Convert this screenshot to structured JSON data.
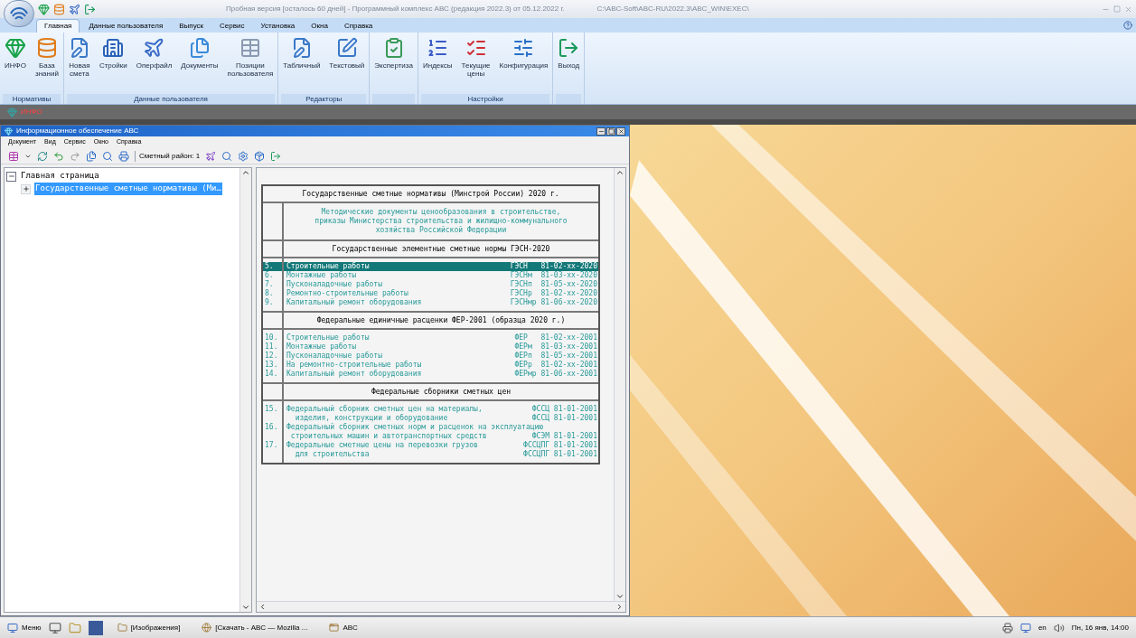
{
  "app": {
    "title": "Пробная версия [осталось 60 дней]  -  Программный комплекс АВС (редакция 2022.3) от 05.12.2022 г.",
    "path": "C:\\ABC-Soft\\ABC-RU\\2022.3\\ABC_WIN\\EXEC\\"
  },
  "ribbon_tabs": [
    {
      "label": "Главная",
      "selected": true
    },
    {
      "label": "Данные пользователя",
      "selected": false
    },
    {
      "label": "Выпуск",
      "selected": false
    },
    {
      "label": "Сервис",
      "selected": false
    },
    {
      "label": "Установка",
      "selected": false
    },
    {
      "label": "Окна",
      "selected": false
    },
    {
      "label": "Справка",
      "selected": false
    }
  ],
  "ribbon_groups": [
    {
      "label": "Нормативы",
      "buttons": [
        {
          "label": "ИНФО",
          "kind": "info"
        },
        {
          "label": "База знаний",
          "kind": "database"
        }
      ]
    },
    {
      "label": "Данные пользователя",
      "buttons": [
        {
          "label": "Новая смета",
          "kind": "estimate"
        },
        {
          "label": "Стройки",
          "kind": "buildings"
        },
        {
          "label": "Оперфайл",
          "kind": "plane"
        },
        {
          "label": "Документы",
          "kind": "documents"
        },
        {
          "label": "Позиции пользователя",
          "kind": "grid"
        }
      ]
    },
    {
      "label": "Редакторы",
      "buttons": [
        {
          "label": "Табличный",
          "kind": "estimate"
        },
        {
          "label": "Текстовый",
          "kind": "pen"
        }
      ]
    },
    {
      "buttons": [
        {
          "label": "Экспертиза",
          "kind": "checklist"
        }
      ]
    },
    {
      "label": "Настройки",
      "buttons": [
        {
          "label": "Индексы",
          "kind": "list"
        },
        {
          "label": "Текущие цены",
          "kind": "prices"
        },
        {
          "label": "Конфигурация",
          "kind": "config"
        }
      ]
    },
    {
      "buttons": [
        {
          "label": "Выход",
          "kind": "exit"
        }
      ]
    }
  ],
  "doc_tab": {
    "label": "ИНФО"
  },
  "window": {
    "title": "Информационное обеспечение АВС",
    "menu": [
      "Документ",
      "Вид",
      "Сервис",
      "Окно",
      "Справка"
    ],
    "region_label": "Сметный район: 1"
  },
  "tree": [
    {
      "label": "Главная страница",
      "expanded": true,
      "selected": false,
      "children": [
        {
          "label": "Государственные сметные нормативы (Ми…",
          "expanded": false,
          "selected": true
        }
      ]
    }
  ],
  "document": {
    "title": "Государственные сметные нормативы (Минстрой России) 2020 г.",
    "info": "Методические документы ценообразования в строительстве,\nприказы Министерства строительства и жилищно-коммунального\nхозяйства Российской Федерации",
    "sections": [
      {
        "heading": "Государственные элементные сметные нормы ГЭСН-2020",
        "items": [
          {
            "number": "5.",
            "selected": true,
            "lines": [
              {
                "text": "Строительные работы",
                "code": "ГЭСН   81-02-xx-2020"
              }
            ]
          },
          {
            "number": "6.",
            "selected": false,
            "lines": [
              {
                "text": "Монтажные работы",
                "code": "ГЭСНм  81-03-xx-2020"
              }
            ]
          },
          {
            "number": "7.",
            "selected": false,
            "lines": [
              {
                "text": "Пусконаладочные работы",
                "code": "ГЭСНп  81-05-xx-2020"
              }
            ]
          },
          {
            "number": "8.",
            "selected": false,
            "lines": [
              {
                "text": "Ремонтно-строительные работы",
                "code": "ГЭСНр  81-02-xx-2020"
              }
            ]
          },
          {
            "number": "9.",
            "selected": false,
            "lines": [
              {
                "text": "Капитальный ремонт оборудования",
                "code": "ГЭСНмр 81-06-xx-2020"
              }
            ]
          }
        ]
      },
      {
        "heading": "Федеральные единичные расценки ФЕР-2001 (образца 2020 г.)",
        "items": [
          {
            "number": "10.",
            "selected": false,
            "lines": [
              {
                "text": "Строительные работы",
                "code": "ФЕР   81-02-xx-2001"
              }
            ]
          },
          {
            "number": "11.",
            "selected": false,
            "lines": [
              {
                "text": "Монтажные работы",
                "code": "ФЕРм  81-03-xx-2001"
              }
            ]
          },
          {
            "number": "12.",
            "selected": false,
            "lines": [
              {
                "text": "Пусконаладочные работы",
                "code": "ФЕРп  81-05-xx-2001"
              }
            ]
          },
          {
            "number": "13.",
            "selected": false,
            "lines": [
              {
                "text": "На ремонтно-строительные работы",
                "code": "ФЕРр  81-02-xx-2001"
              }
            ]
          },
          {
            "number": "14.",
            "selected": false,
            "lines": [
              {
                "text": "Капитальный ремонт оборудования",
                "code": "ФЕРмр 81-06-xx-2001"
              }
            ]
          }
        ]
      },
      {
        "heading": "Федеральные сборники сметных цен",
        "items": [
          {
            "number": "15.",
            "selected": false,
            "lines": [
              {
                "text": "Федеральный сборник сметных цен на материалы,",
                "code": "ФССЦ 81-01-2001"
              },
              {
                "text": "  изделия, конструкции и оборудование",
                "code": "ФССЦ 81-01-2001"
              }
            ]
          },
          {
            "number": "16.",
            "selected": false,
            "lines": [
              {
                "text": "Федеральный сборник сметных норм и расценок на эксплуатацию"
              },
              {
                "text": " строительных машин и автотранспортных средств",
                "code": "ФСЭМ 81-01-2001"
              }
            ]
          },
          {
            "number": "17.",
            "selected": false,
            "lines": [
              {
                "text": "Федеральные сметные цены на перевозки грузов",
                "code": "ФССЦПГ 81-01-2001"
              },
              {
                "text": "  для строительства",
                "code": "ФССЦПГ 81-01-2001"
              }
            ]
          }
        ]
      }
    ]
  },
  "taskbar": {
    "menu": "Меню",
    "tasks": [
      {
        "label": "[Изображения]",
        "kind": "folder"
      },
      {
        "label": "[Скачать - ABC — Mozilla ...",
        "kind": "browser"
      },
      {
        "label": "ABC",
        "kind": "app"
      }
    ],
    "language": "en",
    "clock": "Пн, 16 янв, 14:00"
  }
}
